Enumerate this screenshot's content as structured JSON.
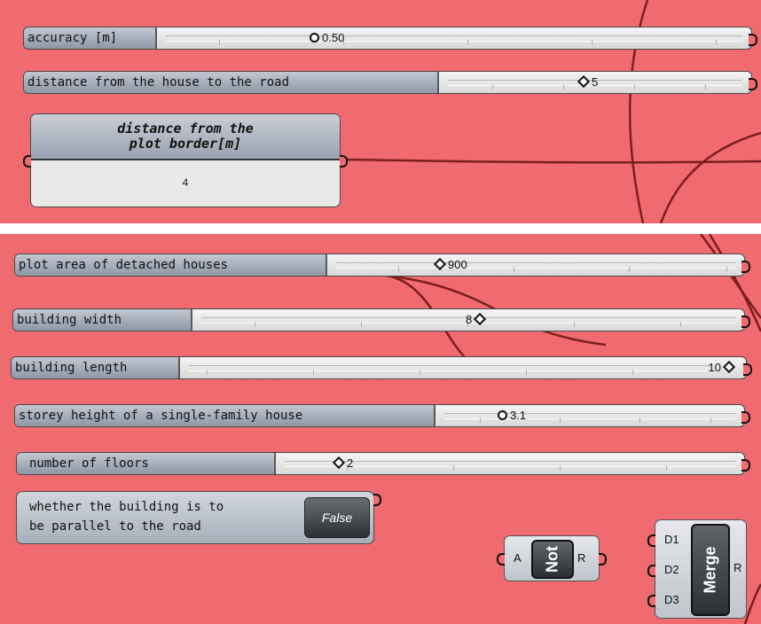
{
  "colors": {
    "canvas": "#ef6b6f",
    "wire": "#7a1f1f",
    "separator": "#ffffff"
  },
  "top_group": {
    "accuracy": {
      "label": "accuracy [m]",
      "value": "0.50",
      "icon": "circle-icon"
    },
    "distance_road": {
      "label": "distance from the house to the road",
      "value": "5",
      "icon": "diamond-icon"
    },
    "panel": {
      "title_line1": "distance from the",
      "title_line2": "plot border[m]",
      "value": "4"
    }
  },
  "bottom_group": {
    "plot_area": {
      "label": "plot area of detached houses",
      "value": "900",
      "icon": "diamond-icon"
    },
    "building_width": {
      "label": "building width",
      "value": "8",
      "icon": "diamond-icon"
    },
    "building_length": {
      "label": "building length",
      "value": "10",
      "icon": "diamond-icon"
    },
    "storey_height": {
      "label": "storey height of a single-family house",
      "value": "3.1",
      "icon": "circle-icon"
    },
    "number_floors": {
      "label": "number of floors",
      "value": "2",
      "icon": "diamond-icon"
    },
    "toggle": {
      "line1": "whether the building is to",
      "line2": "be parallel to the road",
      "value": "False"
    },
    "not_component": {
      "name": "Not",
      "input": "A",
      "output": "R"
    },
    "merge_component": {
      "name": "Merge",
      "inputs": [
        "D1",
        "D2",
        "D3"
      ],
      "output": "R"
    }
  }
}
